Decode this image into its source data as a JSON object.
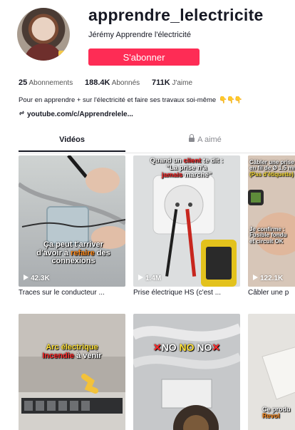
{
  "profile": {
    "username": "apprendre_lelectricite",
    "display_name": "Jérémy Apprendre l'électricité",
    "follow_label": "S'abonner"
  },
  "stats": {
    "following_count": "25",
    "following_label": "Abonnements",
    "followers_count": "188.4K",
    "followers_label": "Abonnés",
    "likes_count": "711K",
    "likes_label": "J'aime"
  },
  "bio": {
    "text": "Pour en apprendre + sur l'électricité et faire ses travaux soi-même",
    "emoji": "👇👇👇",
    "link": "youtube.com/c/Apprendrelele..."
  },
  "tabs": {
    "videos": "Vidéos",
    "liked": "A aimé"
  },
  "videos": [
    {
      "views": "42.3K",
      "caption": "Traces sur le conducteur ...",
      "overlay": [
        "Ça peut t'arriver",
        "d'avoir à ",
        "refaire",
        " des connexions"
      ]
    },
    {
      "views": "1.4M",
      "caption": "Prise électrique HS (c'est ...",
      "overlay": [
        "Quand un ",
        "client",
        " te dit :",
        "\"La prise n'a",
        "jamais",
        " marché\""
      ]
    },
    {
      "views": "122.1K",
      "caption": "Câbler une p",
      "overlay_top": [
        "Câbler une prise",
        "en fil de Ø 1.5 mm",
        "(Pas d'étiquette)"
      ],
      "overlay_mid": [
        "Je confirme :",
        "Fusible fondu",
        "et circuit OK"
      ]
    },
    {
      "overlay": [
        "Arc électrique",
        "Incendie",
        " à venir"
      ]
    },
    {
      "overlay": [
        "NO",
        "NO",
        "NO"
      ]
    },
    {
      "overlay": [
        "Ce produ",
        "Revol"
      ]
    }
  ]
}
